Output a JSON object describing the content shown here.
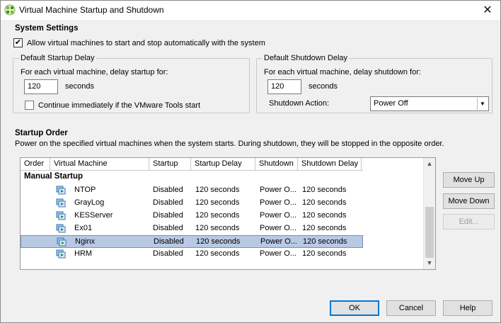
{
  "window": {
    "title": "Virtual Machine Startup and Shutdown",
    "close_glyph": "✕"
  },
  "system_settings": {
    "title": "System Settings",
    "auto_start_checked": true,
    "auto_start_label": "Allow virtual machines to start and stop automatically with the system"
  },
  "startup_delay": {
    "legend": "Default Startup Delay",
    "label": "For each virtual machine, delay startup for:",
    "value": "120",
    "unit": "seconds",
    "continue_checked": false,
    "continue_label": "Continue immediately if the VMware Tools start"
  },
  "shutdown_delay": {
    "legend": "Default Shutdown Delay",
    "label": "For each virtual machine, delay shutdown for:",
    "value": "120",
    "unit": "seconds",
    "action_label": "Shutdown Action:",
    "action_value": "Power Off"
  },
  "startup_order": {
    "title": "Startup Order",
    "description": "Power on the specified virtual machines when the system starts. During shutdown, they will be stopped in the opposite order.",
    "columns": [
      "Order",
      "Virtual Machine",
      "Startup",
      "Startup Delay",
      "Shutdown",
      "Shutdown Delay"
    ],
    "group_label": "Manual Startup",
    "rows": [
      {
        "vm": "NTOP",
        "startup": "Disabled",
        "startup_delay": "120 seconds",
        "shutdown": "Power O...",
        "shutdown_delay": "120 seconds"
      },
      {
        "vm": "GrayLog",
        "startup": "Disabled",
        "startup_delay": "120 seconds",
        "shutdown": "Power O...",
        "shutdown_delay": "120 seconds"
      },
      {
        "vm": "KESServer",
        "startup": "Disabled",
        "startup_delay": "120 seconds",
        "shutdown": "Power O...",
        "shutdown_delay": "120 seconds"
      },
      {
        "vm": "Ex01",
        "startup": "Disabled",
        "startup_delay": "120 seconds",
        "shutdown": "Power O...",
        "shutdown_delay": "120 seconds"
      },
      {
        "vm": "Nginx",
        "startup": "Disabled",
        "startup_delay": "120 seconds",
        "shutdown": "Power O...",
        "shutdown_delay": "120 seconds",
        "selected": true
      },
      {
        "vm": "HRM",
        "startup": "Disabled",
        "startup_delay": "120 seconds",
        "shutdown": "Power O...",
        "shutdown_delay": "120 seconds"
      }
    ],
    "move_up": "Move Up",
    "move_down": "Move Down",
    "edit": "Edit..."
  },
  "footer": {
    "ok": "OK",
    "cancel": "Cancel",
    "help": "Help"
  },
  "colors": {
    "selection": "#b8c9e4",
    "accent": "#0078d7"
  }
}
